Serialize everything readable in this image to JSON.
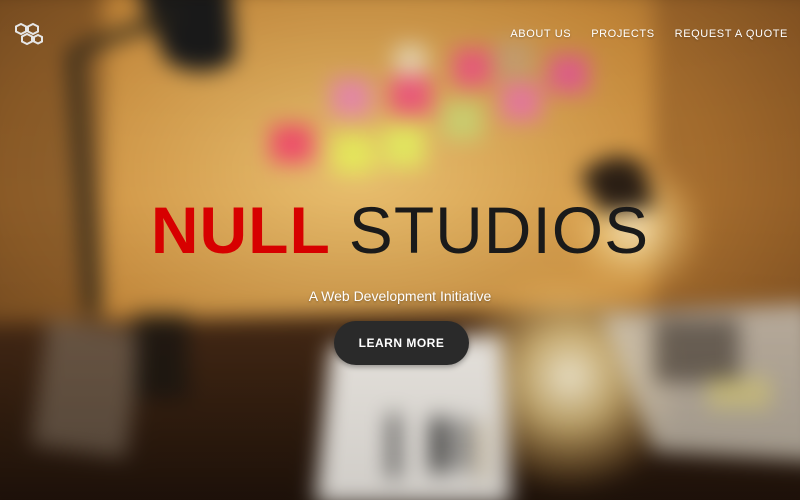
{
  "brand": {
    "logo_icon": "hexagon-cluster-logo-icon"
  },
  "nav": {
    "items": [
      {
        "label": "ABOUT US"
      },
      {
        "label": "PROJECTS"
      },
      {
        "label": "REQUEST A QUOTE"
      }
    ]
  },
  "hero": {
    "title_bold": "NULL",
    "title_light": "STUDIOS",
    "tagline": "A Web Development Initiative",
    "cta_label": "LEARN MORE"
  },
  "colors": {
    "accent_red": "#d70000",
    "button_bg": "#2a2a2a",
    "wall": "#d9a050"
  }
}
